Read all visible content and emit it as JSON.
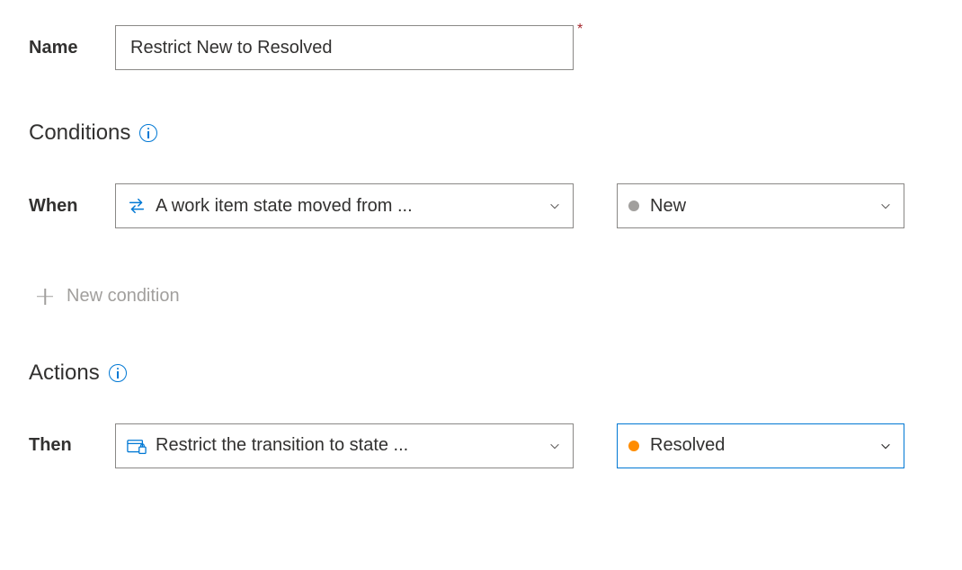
{
  "labels": {
    "name": "Name",
    "when": "When",
    "then": "Then"
  },
  "name_field": {
    "value": "Restrict New to Resolved"
  },
  "sections": {
    "conditions": "Conditions",
    "actions": "Actions"
  },
  "condition": {
    "type_label": "A work item state moved from ...",
    "state_label": "New"
  },
  "add_condition_label": "New condition",
  "action": {
    "type_label": "Restrict the transition to state ...",
    "state_label": "Resolved"
  }
}
